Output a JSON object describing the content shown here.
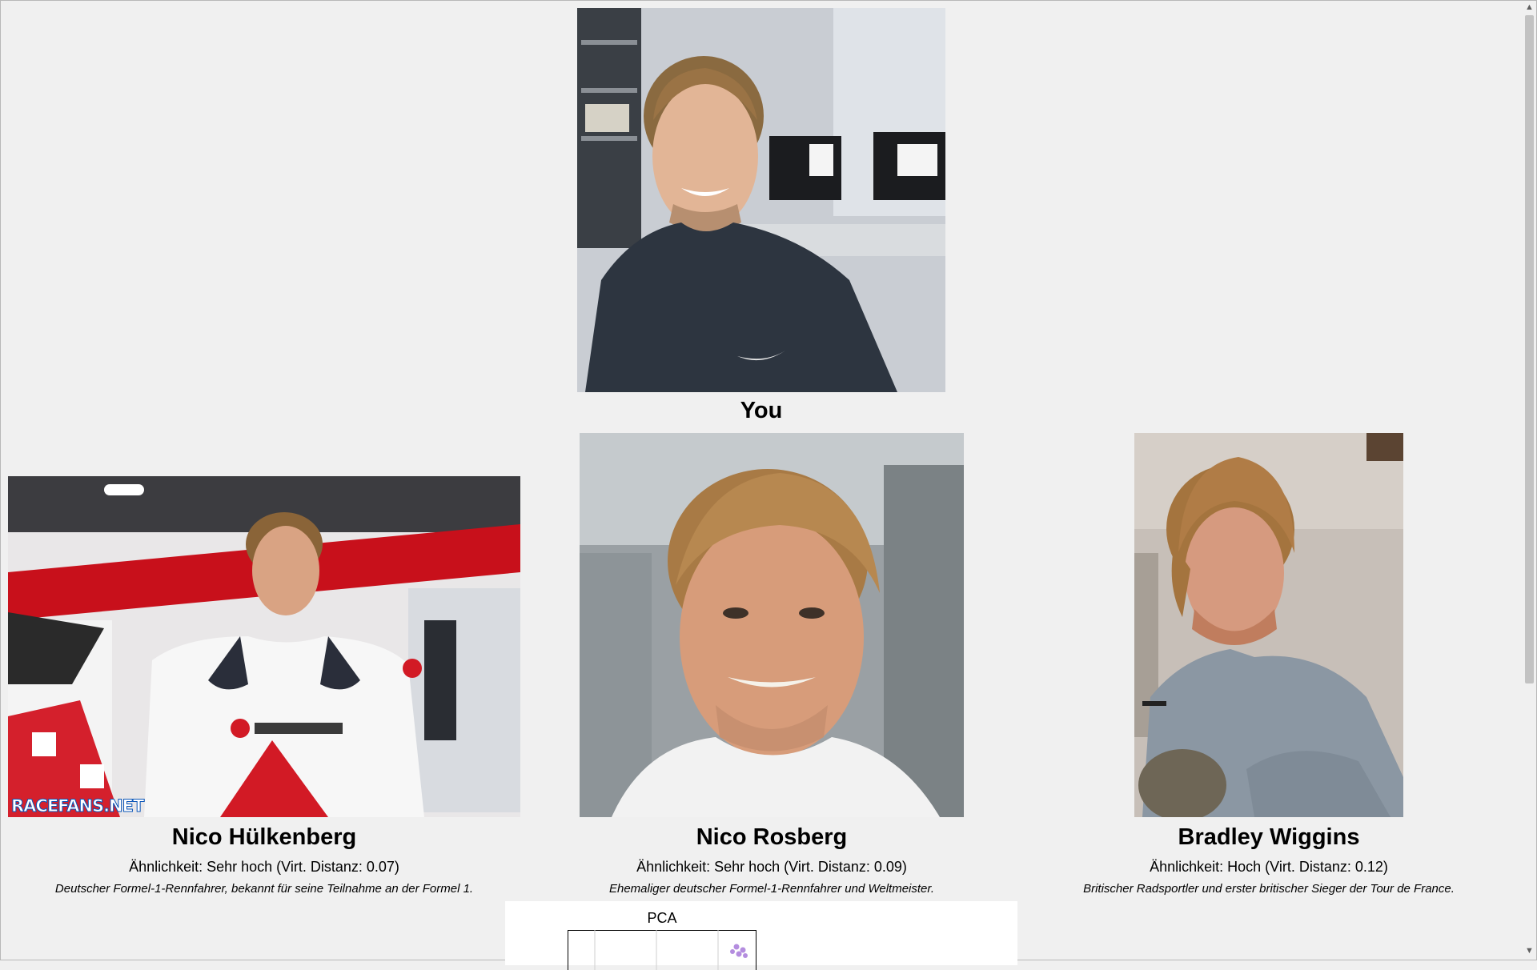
{
  "you": {
    "label": "You"
  },
  "matches": [
    {
      "name": "Nico Hülkenberg",
      "similarity": "Ähnlichkeit: Sehr hoch (Virt. Distanz: 0.07)",
      "description": "Deutscher Formel-1-Rennfahrer, bekannt für seine Teilnahme an der Formel 1.",
      "photo_watermark": "RACEFANS.NET"
    },
    {
      "name": "Nico Rosberg",
      "similarity": "Ähnlichkeit: Sehr hoch (Virt. Distanz: 0.09)",
      "description": "Ehemaliger deutscher Formel-1-Rennfahrer und Weltmeister."
    },
    {
      "name": "Bradley Wiggins",
      "similarity": "Ähnlichkeit: Hoch (Virt. Distanz: 0.12)",
      "description": "Britischer Radsportler und erster britischer Sieger der Tour de France."
    }
  ],
  "pca": {
    "title": "PCA"
  },
  "scrollbar": {
    "up_icon": "chevron-up-icon",
    "down_icon": "chevron-down-icon"
  }
}
